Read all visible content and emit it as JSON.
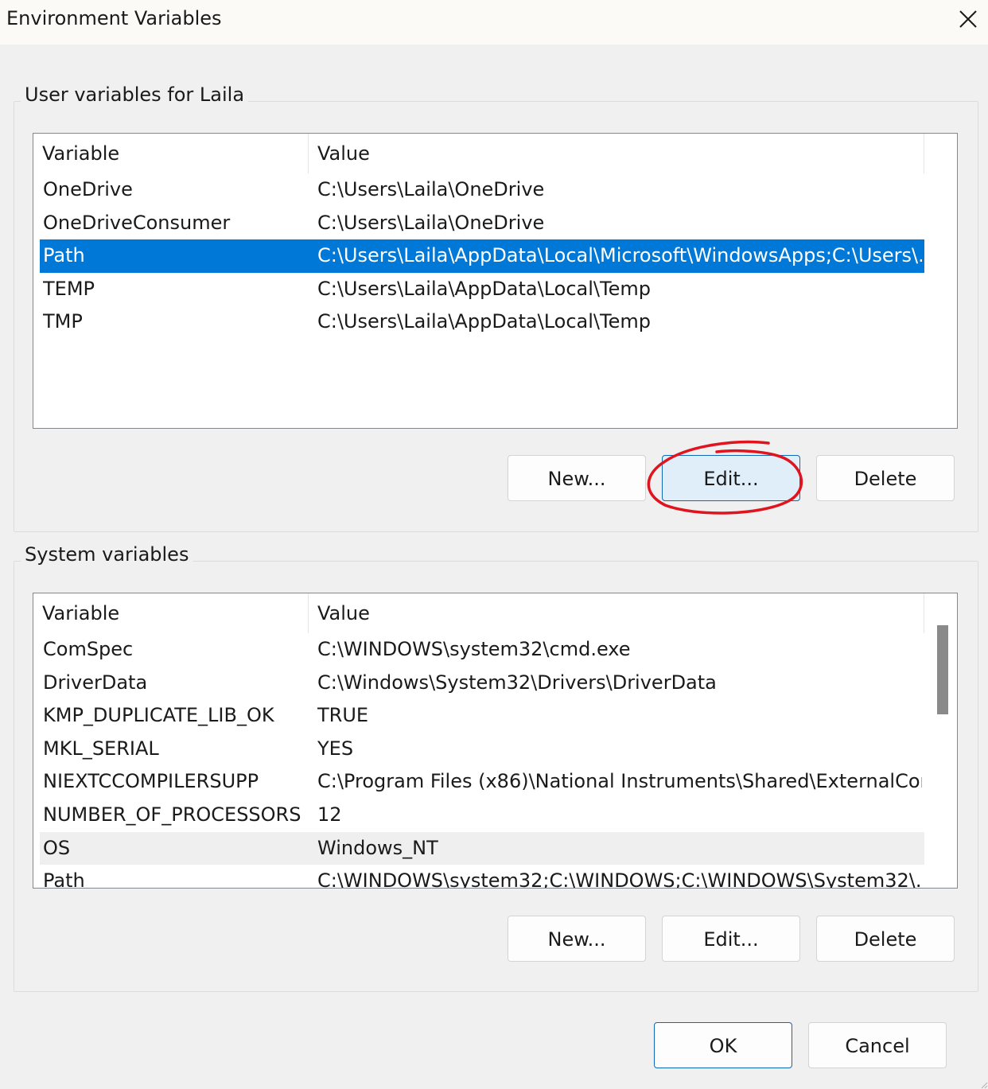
{
  "window": {
    "title": "Environment Variables"
  },
  "user_section": {
    "legend": "User variables for Laila",
    "columns": [
      "Variable",
      "Value"
    ],
    "rows": [
      {
        "variable": "OneDrive",
        "value": "C:\\Users\\Laila\\OneDrive"
      },
      {
        "variable": "OneDriveConsumer",
        "value": "C:\\Users\\Laila\\OneDrive"
      },
      {
        "variable": "Path",
        "value": "C:\\Users\\Laila\\AppData\\Local\\Microsoft\\WindowsApps;C:\\Users\\..."
      },
      {
        "variable": "TEMP",
        "value": "C:\\Users\\Laila\\AppData\\Local\\Temp"
      },
      {
        "variable": "TMP",
        "value": "C:\\Users\\Laila\\AppData\\Local\\Temp"
      }
    ],
    "selected_variable": "Path",
    "buttons": {
      "new": "New...",
      "edit": "Edit...",
      "delete": "Delete"
    }
  },
  "system_section": {
    "legend": "System variables",
    "columns": [
      "Variable",
      "Value"
    ],
    "rows": [
      {
        "variable": "ComSpec",
        "value": "C:\\WINDOWS\\system32\\cmd.exe"
      },
      {
        "variable": "DriverData",
        "value": "C:\\Windows\\System32\\Drivers\\DriverData"
      },
      {
        "variable": "KMP_DUPLICATE_LIB_OK",
        "value": "TRUE"
      },
      {
        "variable": "MKL_SERIAL",
        "value": "YES"
      },
      {
        "variable": "NIEXTCCOMPILERSUPP",
        "value": "C:\\Program Files (x86)\\National Instruments\\Shared\\ExternalCom..."
      },
      {
        "variable": "NUMBER_OF_PROCESSORS",
        "value": "12"
      },
      {
        "variable": "OS",
        "value": "Windows_NT"
      },
      {
        "variable": "Path",
        "value": "C:\\WINDOWS\\system32;C:\\WINDOWS;C:\\WINDOWS\\System32\\..."
      }
    ],
    "hovered_variable": "OS",
    "buttons": {
      "new": "New...",
      "edit": "Edit...",
      "delete": "Delete"
    }
  },
  "footer": {
    "ok": "OK",
    "cancel": "Cancel"
  },
  "icons": {
    "close": "close-icon"
  },
  "colors": {
    "selection": "#0078d7",
    "accent_border": "#0f68b8",
    "annotation": "#e0141e"
  }
}
